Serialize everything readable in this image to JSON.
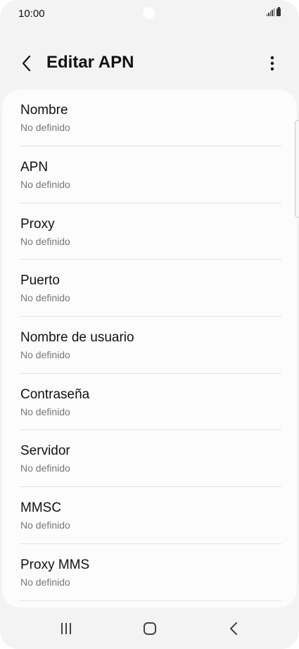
{
  "status_bar": {
    "time": "10:00"
  },
  "app_bar": {
    "title": "Editar APN"
  },
  "fields": [
    {
      "label": "Nombre",
      "value": "No definido"
    },
    {
      "label": "APN",
      "value": "No definido"
    },
    {
      "label": "Proxy",
      "value": "No definido"
    },
    {
      "label": "Puerto",
      "value": "No definido"
    },
    {
      "label": "Nombre de usuario",
      "value": "No definido"
    },
    {
      "label": "Contraseña",
      "value": "No definido"
    },
    {
      "label": "Servidor",
      "value": "No definido"
    },
    {
      "label": "MMSC",
      "value": "No definido"
    },
    {
      "label": "Proxy MMS",
      "value": "No definido"
    }
  ],
  "icons": {
    "back": "chevron-left-icon",
    "more": "more-vertical-icon",
    "nav_recent": "recent-apps-icon",
    "nav_home": "home-icon",
    "nav_back": "back-icon"
  }
}
